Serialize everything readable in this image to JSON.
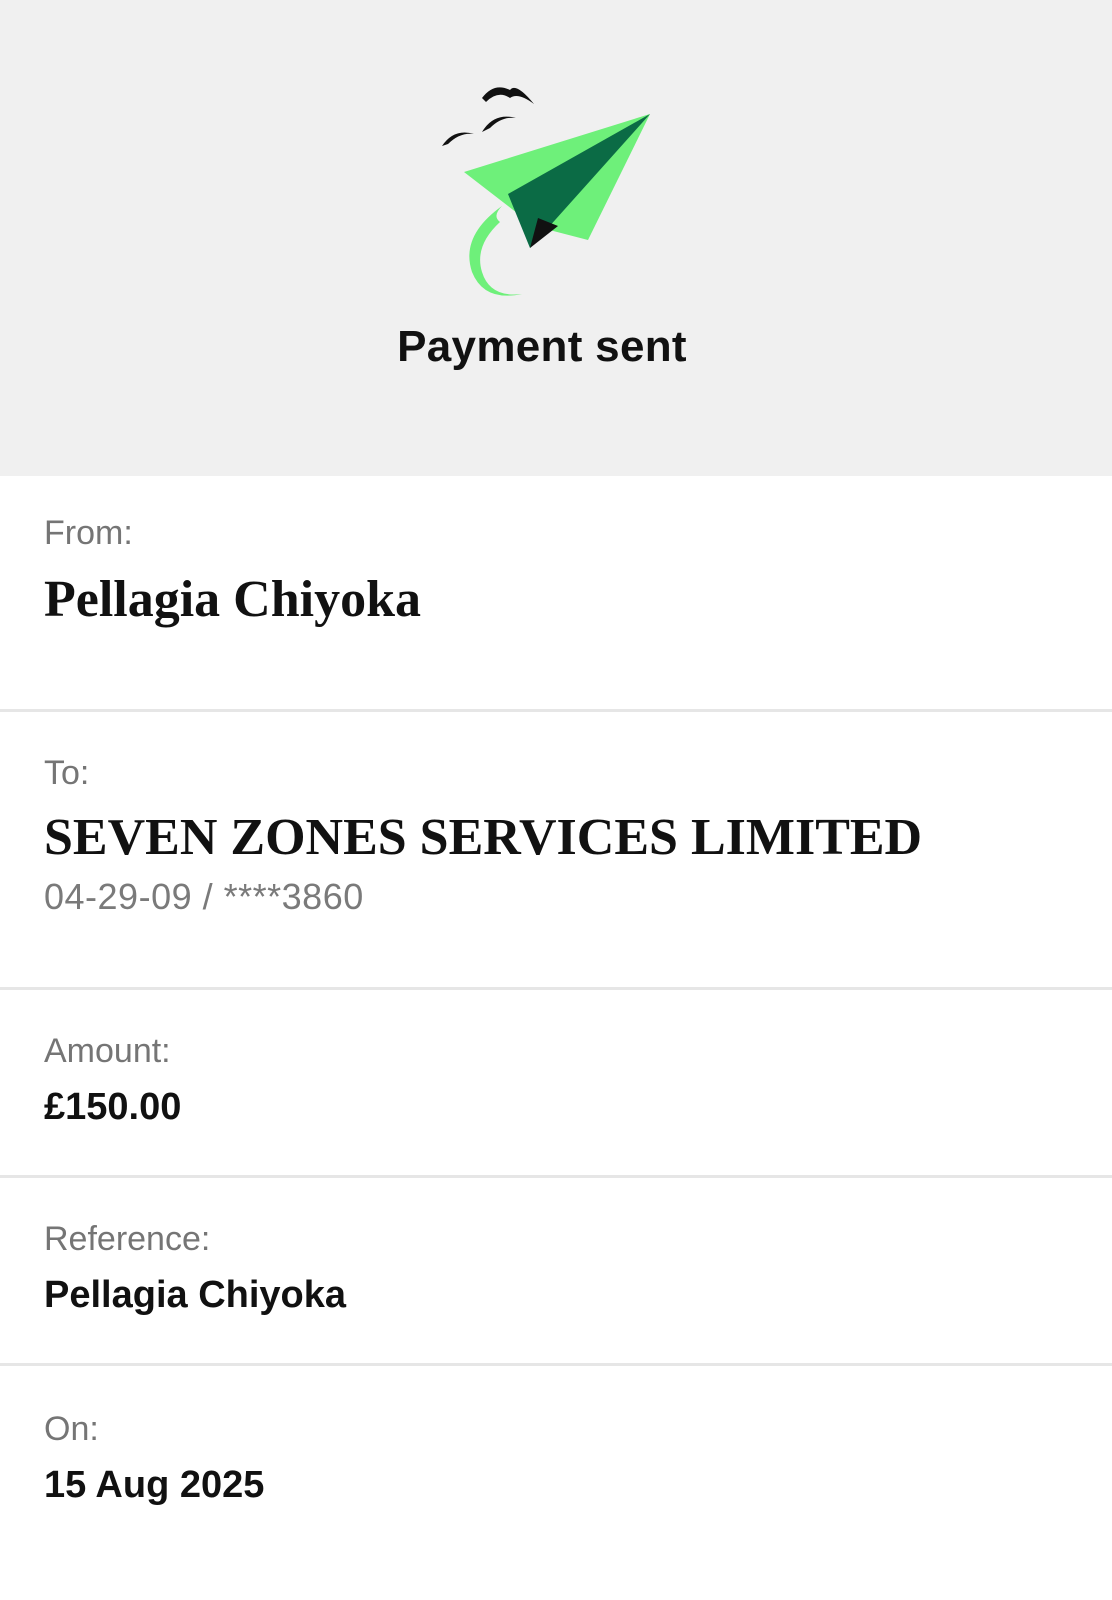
{
  "header": {
    "title": "Payment sent",
    "illustration_icon": "paper-plane-with-birds",
    "colors": {
      "plane_light": "#6ef07a",
      "plane_dark": "#0b6b45",
      "birds": "#111111",
      "header_bg": "#f0f0f0"
    }
  },
  "details": {
    "from": {
      "label": "From:",
      "value": "Pellagia Chiyoka"
    },
    "to": {
      "label": "To:",
      "value": "SEVEN ZONES SERVICES LIMITED",
      "account": "04-29-09 / ****3860"
    },
    "amount": {
      "label": "Amount:",
      "value": "£150.00"
    },
    "reference": {
      "label": "Reference:",
      "value": "Pellagia Chiyoka"
    },
    "on": {
      "label": "On:",
      "value": "15 Aug 2025"
    }
  }
}
